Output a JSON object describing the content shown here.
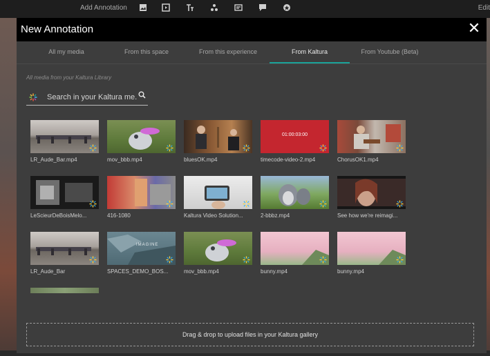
{
  "toolbar": {
    "add_annotation": "Add Annotation",
    "edit": "Edit",
    "tools": [
      "image-icon",
      "video-icon",
      "text-icon",
      "hotspot-icon",
      "card-icon",
      "comment-icon",
      "badge-icon"
    ]
  },
  "modal": {
    "title": "New Annotation",
    "close_icon": "close-icon"
  },
  "tabs": [
    {
      "label": "All my media",
      "active": false
    },
    {
      "label": "From this space",
      "active": false
    },
    {
      "label": "From this experience",
      "active": false
    },
    {
      "label": "From Kaltura",
      "active": true
    },
    {
      "label": "From Youtube (Beta)",
      "active": false
    }
  ],
  "library_note": "All media from your Kaltura Library",
  "search": {
    "placeholder": "Search in your Kaltura me..."
  },
  "media": [
    {
      "name": "LR_Aude_Bar.mp4"
    },
    {
      "name": "mov_bbb.mp4"
    },
    {
      "name": "bluesOK.mp4"
    },
    {
      "name": "timecode-video-2.mp4",
      "timecode": "01:00:03:00"
    },
    {
      "name": "ChorusOK1.mp4"
    },
    {
      "name": "LeScieurDeBoisMelo..."
    },
    {
      "name": "416-1080"
    },
    {
      "name": "Kaltura Video Solution..."
    },
    {
      "name": "2-bbbz.mp4"
    },
    {
      "name": "See how we're reimagi..."
    },
    {
      "name": "LR_Aude_Bar"
    },
    {
      "name": "SPACES_DEMO_BOS..."
    },
    {
      "name": "mov_bbb.mp4"
    },
    {
      "name": "bunny.mp4"
    },
    {
      "name": "bunny.mp4"
    }
  ],
  "thumb_overlay_text": "IMAGINE",
  "dropzone": "Drag & drop to upload files in your Kaltura gallery",
  "colors": {
    "accent": "#1aa39a",
    "header": "#000000",
    "panel": "#3d3d3d",
    "timecode_bg": "#c4262f"
  }
}
